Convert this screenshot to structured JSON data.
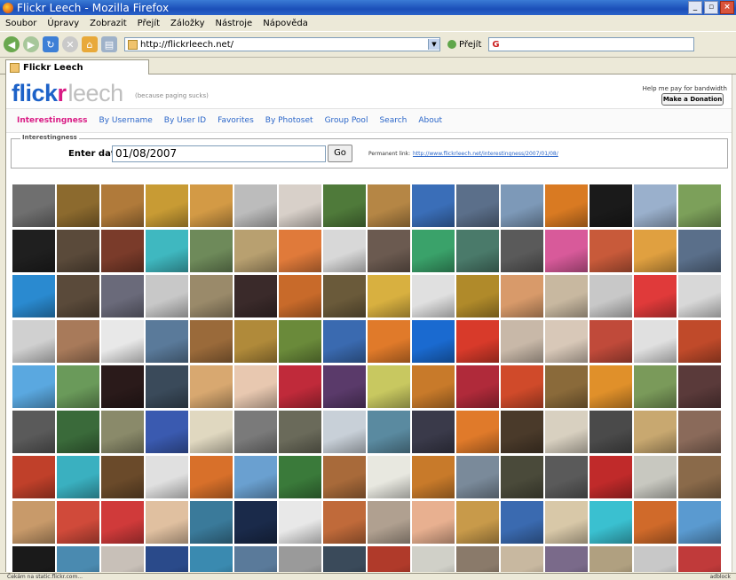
{
  "window": {
    "title": "Flickr Leech - Mozilla Firefox"
  },
  "menu": [
    "Soubor",
    "Úpravy",
    "Zobrazit",
    "Přejít",
    "Záložky",
    "Nástroje",
    "Nápověda"
  ],
  "toolbar": {
    "url": "http://flickrleech.net/",
    "go_label": "Přejít"
  },
  "tab": {
    "label": "Flickr Leech"
  },
  "site": {
    "logo_flick": "flick",
    "logo_r": "r",
    "logo_leech": "leech",
    "tagline": "(because paging sucks)",
    "donate_text": "Help me pay for bandwidth",
    "donate_button": "Make a Donation",
    "nav": [
      "Interestingness",
      "By Username",
      "By User ID",
      "Favorites",
      "By Photoset",
      "Group Pool",
      "Search",
      "About"
    ],
    "form_legend": "Interestingness",
    "date_label": "Enter date",
    "date_value": "01/08/2007",
    "go_button": "Go",
    "permalink_label": "Permanent link:",
    "permalink_url": "http://www.flickrleech.net/interestingness/2007/01/08/"
  },
  "status": {
    "left": "Čekám na static.flickr.com...",
    "right": "adblock"
  },
  "thumbnails": [
    "#6f6f6f",
    "#8c6a2e",
    "#b07a3a",
    "#c89b34",
    "#d39a45",
    "#bcbcbc",
    "#d8d0c9",
    "#4f7a3a",
    "#b58645",
    "#3a6eb8",
    "#5b6f8a",
    "#7d99b8",
    "#d97a22",
    "#1a1a1a",
    "#9ab0cc",
    "#7ca05a",
    "#1f1f1f",
    "#5a4a3a",
    "#7a3b2a",
    "#3fb8c0",
    "#6e8a5a",
    "#b8a070",
    "#e07a3a",
    "#d8d8d8",
    "#6b5a50",
    "#3aa26a",
    "#4a7a6a",
    "#5a5a5a",
    "#d85a9a",
    "#c85a3a",
    "#e0a040",
    "#5a6f8a",
    "#2a8ad0",
    "#5a4a3a",
    "#6a6a7a",
    "#c8c8c8",
    "#9a8a6a",
    "#3a2a2a",
    "#c86a2a",
    "#6a5a3a",
    "#d8b040",
    "#e0e0e0",
    "#b08a2a",
    "#d89a6a",
    "#c8b8a0",
    "#c8c8c8",
    "#e03a3a",
    "#d8d8d8",
    "#d0d0d0",
    "#a87a5a",
    "#e8e8e8",
    "#5a7a9a",
    "#9a6a3a",
    "#b08a3a",
    "#6a8a3a",
    "#3a6ab0",
    "#e07a2a",
    "#1a6ad0",
    "#d83a2a",
    "#c8b8a8",
    "#d8c8b8",
    "#c04a3a",
    "#e0e0e0",
    "#c04a2a",
    "#5aa8e0",
    "#6a9a5a",
    "#2a1a1a",
    "#3a4a5a",
    "#d8a870",
    "#e8c8b0",
    "#c02a3a",
    "#5a3a6a",
    "#c8c860",
    "#c87a2a",
    "#b02a3a",
    "#d04a2a",
    "#8a6a3a",
    "#e0902a",
    "#7a9a5a",
    "#5a3a3a",
    "#5a5a5a",
    "#3a6a3a",
    "#8a8a6a",
    "#3a5ab0",
    "#e0d8c0",
    "#7a7a7a",
    "#6a6a5a",
    "#c8d0d8",
    "#5a8aa0",
    "#3a3a4a",
    "#e07a2a",
    "#4a3a2a",
    "#d8d0c0",
    "#4a4a4a",
    "#c8a870",
    "#8a6a5a",
    "#c0402a",
    "#3ab0c0",
    "#6a4a2a",
    "#e0e0e0",
    "#d8702a",
    "#6aa0d0",
    "#3a7a3a",
    "#a86a3a",
    "#e8e8e0",
    "#c87a2a",
    "#7a8a9a",
    "#4a4a3a",
    "#5a5a5a",
    "#c02a2a",
    "#c8c8c0",
    "#8a6a4a",
    "#c89a6a",
    "#d04a3a",
    "#d03a3a",
    "#e0c0a0",
    "#3a7a9a",
    "#1a2a4a",
    "#e8e8e8",
    "#c06a3a",
    "#b0a090",
    "#e8b090",
    "#c89a4a",
    "#3a6ab0",
    "#d8c8a8",
    "#3ac0d0",
    "#d06a2a",
    "#5a9ad0",
    "#1a1a1a",
    "#4a8ab0",
    "#c8c0b8",
    "#2a4a8a",
    "#3a8ab0",
    "#5a7a9a",
    "#9a9a9a",
    "#3a4a5a",
    "#b03a2a",
    "#d0d0c8",
    "#8a7a6a",
    "#c8b8a0",
    "#7a6a8a",
    "#b0a080",
    "#c8c8c8",
    "#c03a3a"
  ]
}
